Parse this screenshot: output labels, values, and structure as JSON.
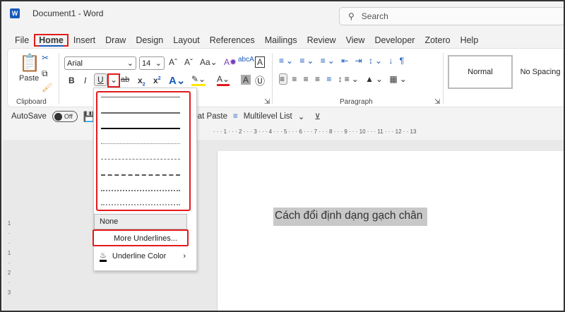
{
  "window": {
    "title": "Document1  -  Word",
    "app_icon": "W"
  },
  "search": {
    "placeholder": "Search"
  },
  "tabs": [
    "File",
    "Home",
    "Insert",
    "Draw",
    "Design",
    "Layout",
    "References",
    "Mailings",
    "Review",
    "View",
    "Developer",
    "Zotero",
    "Help"
  ],
  "ribbon": {
    "clipboard": {
      "paste": "Paste",
      "label": "Clipboard"
    },
    "font": {
      "name": "Arial",
      "size": "14"
    },
    "paragraph": {
      "label": "Paragraph"
    },
    "styles": [
      "Normal",
      "No Spacing"
    ]
  },
  "qat": {
    "autosave": "AutoSave",
    "toggle": "Off",
    "save_partial": "S",
    "repeat_paste": "peat Paste",
    "multilevel": "Multilevel List"
  },
  "ruler": "· · · 1 · · · 2 · · · 3 · · · 4 · · · 5 · · · 6 · · · 7 · · · 8 · · · 9 · · · 10 · · · 11 · · · 12 · · 13",
  "vruler": [
    "1",
    "·",
    "·",
    "1",
    "·",
    "2",
    "·",
    "3"
  ],
  "document": {
    "text": "Cách đổi định dạng gạch chân"
  },
  "underline_menu": {
    "styles": [
      "single",
      "thick",
      "double-weight",
      "dotted",
      "dashed",
      "dash-dot",
      "dash-dot-dot",
      "wave"
    ],
    "none": "None",
    "more": "More Underlines...",
    "color": "Underline Color"
  },
  "colors": {
    "accent": "#185abd",
    "highlight": "#e31b1b"
  }
}
